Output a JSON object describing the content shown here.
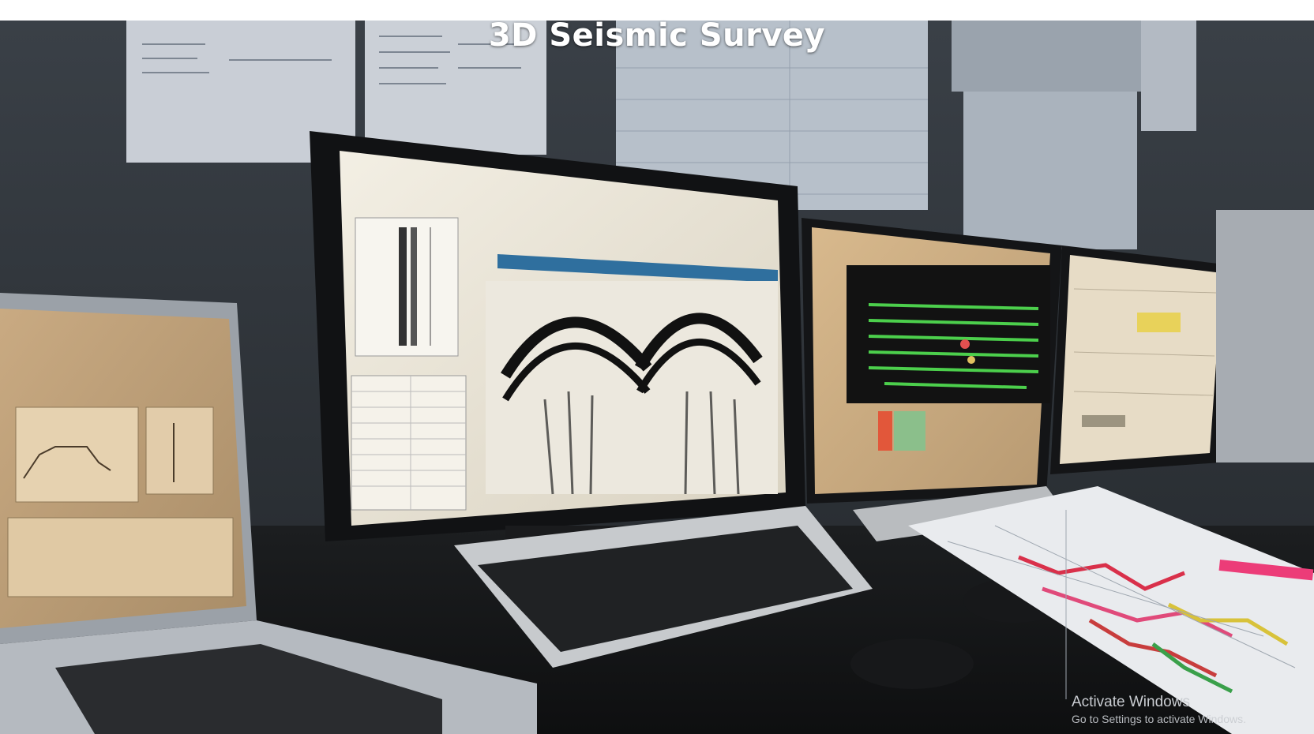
{
  "title": "3D Seismic Survey",
  "watermark": {
    "title": "Activate Windows",
    "subtitle": "Go to Settings to activate Windows."
  },
  "colors": {
    "title_text": "#ffffff",
    "watermark_text": "#c9ccd1",
    "page_background": "#ffffff"
  }
}
